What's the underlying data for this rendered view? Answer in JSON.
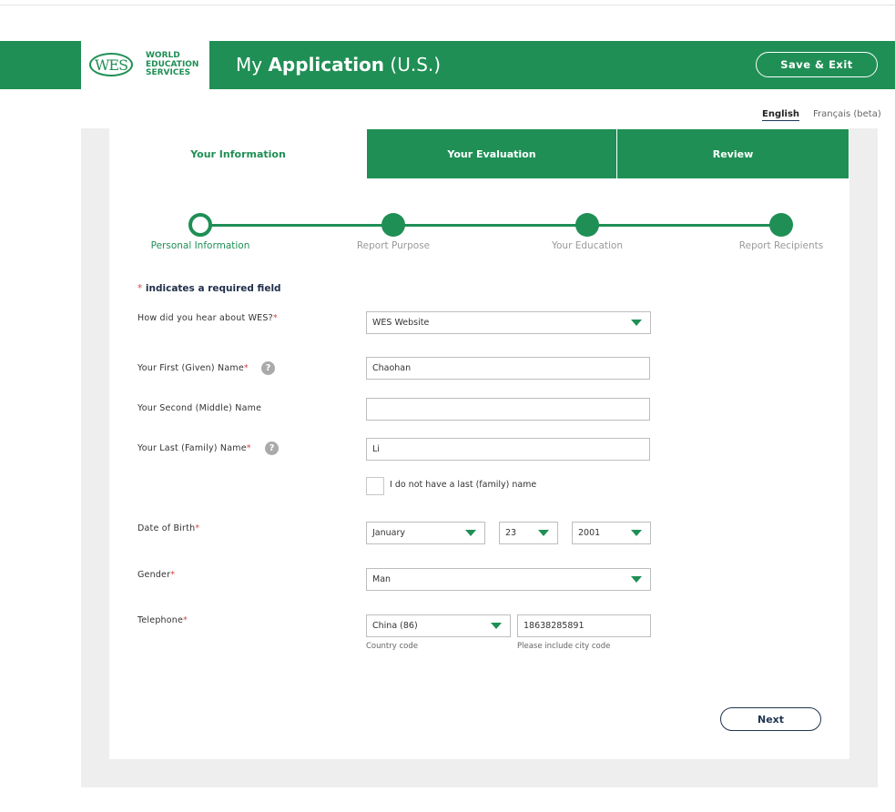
{
  "header": {
    "logo_oval": "WES",
    "logo_line1": "WORLD",
    "logo_line2": "EDUCATION",
    "logo_line3": "SERVICES",
    "title_prefix": "My",
    "title_bold": "Application",
    "title_suffix": "(U.S.)",
    "save_exit": "Save & Exit"
  },
  "language": {
    "english": "English",
    "french": "Français (beta)"
  },
  "tabs": [
    {
      "label": "Your Information"
    },
    {
      "label": "Your Evaluation"
    },
    {
      "label": "Review"
    }
  ],
  "steps": [
    {
      "label": "Personal Information"
    },
    {
      "label": "Report Purpose"
    },
    {
      "label": "Your Education"
    },
    {
      "label": "Report Recipients"
    }
  ],
  "form": {
    "required_star": "*",
    "required_note": "indicates a required field",
    "hear_label": "How did you hear about WES?",
    "hear_value": "WES Website",
    "first_label": "Your First (Given) Name",
    "first_value": "Chaohan",
    "middle_label": "Your Second (Middle) Name",
    "middle_value": "",
    "last_label": "Your Last (Family) Name",
    "last_value": "Li",
    "no_last_label": "I do not have a last (family) name",
    "dob_label": "Date of Birth",
    "dob_month": "January",
    "dob_day": "23",
    "dob_year": "2001",
    "gender_label": "Gender",
    "gender_value": "Man",
    "phone_label": "Telephone",
    "country_code": "China (86)",
    "phone_number": "18638285891",
    "country_hint": "Country code",
    "phone_hint": "Please include city code",
    "help_glyph": "?"
  },
  "next": "Next",
  "colors": {
    "brand_green": "#1f8f55",
    "required_red": "#d64545",
    "navy": "#1f3550"
  }
}
